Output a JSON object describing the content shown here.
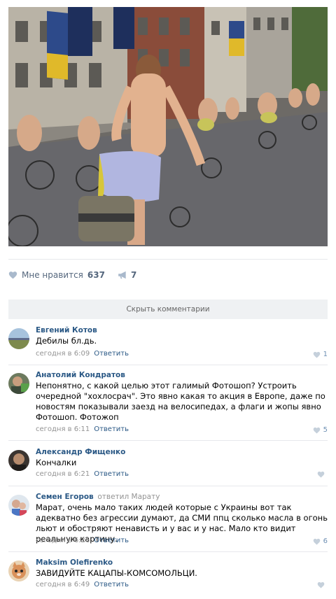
{
  "post": {
    "image_alt": "Фото велопробега",
    "likes_label": "Мне нравится",
    "likes_count": "637",
    "shares_count": "7"
  },
  "comments_toggle_label": "Скрыть комментарии",
  "comments": [
    {
      "author": "Евгений Котов",
      "text": "Дебилы бл.дь.",
      "time": "сегодня в 6:09",
      "reply_label": "Ответить",
      "likes": "1"
    },
    {
      "author": "Анатолий Кондратов",
      "text": "Непонятно, с какой целью этот галимый Фотошоп? Устроить очередной \"хохлосрач\". Это явно какая то акция в Европе, даже по новостям показывали заезд на велосипедах, а флаги и жопы явно Фотошоп. Фотожоп",
      "time": "сегодня в 6:11",
      "reply_label": "Ответить",
      "likes": "5"
    },
    {
      "author": "Александр Фищенко",
      "text": "Кончалки",
      "time": "сегодня в 6:21",
      "reply_label": "Ответить",
      "likes": ""
    },
    {
      "author": "Семен Егоров",
      "reply_to": "ответил Марату",
      "text": "Марат, очень мало таких людей которые с Украины вот так адекватно без агрессии думают, да СМИ ппц сколько масла в огонь льют и обостряют ненависть и у вас и у нас. Мало кто видит реальную картину.",
      "time": "сегодня в 6:26",
      "reply_label": "Ответить",
      "likes": "6"
    },
    {
      "author": "Maksim Olefirenko",
      "text": "ЗАВИДУЙТЕ КАЦАПЫ-КОМСОМОЛЬЦИ.",
      "time": "сегодня в 6:49",
      "reply_label": "Ответить",
      "likes": ""
    }
  ],
  "colors": {
    "link": "#2a5885",
    "meta": "#939393",
    "like_icon": "#6d8fb3",
    "separator": "#e7e8ec"
  }
}
